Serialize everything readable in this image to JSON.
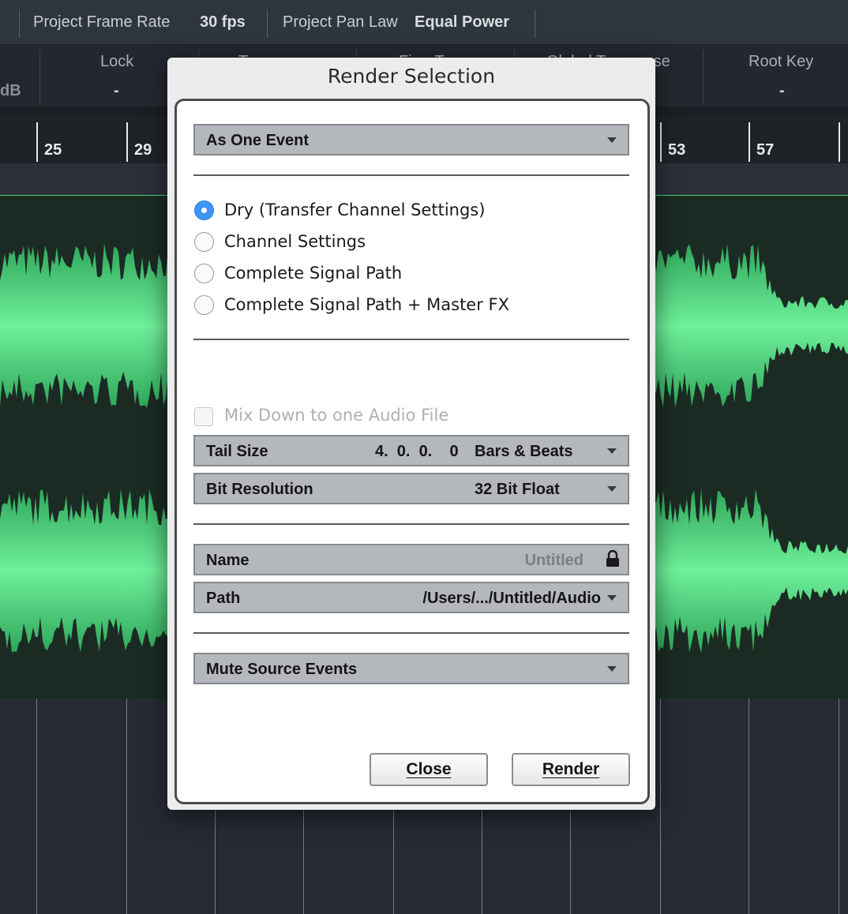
{
  "topbar": {
    "frame_rate_label": "Project Frame Rate",
    "frame_rate_value": "30 fps",
    "pan_law_label": "Project Pan Law",
    "pan_law_value": "Equal Power"
  },
  "infoline": {
    "db_value": "dB",
    "lock_label": "Lock",
    "lock_value": "-",
    "transpose_label": "Transpose",
    "fine_tune_label": "Fine-Tune",
    "global_transpose_label": "Global Transpose",
    "root_key_label": "Root Key",
    "root_key_value": "-"
  },
  "ruler": {
    "bars": [
      "25",
      "29",
      "53",
      "57"
    ]
  },
  "dialog": {
    "title": "Render Selection",
    "mode_select": "As One Event",
    "options": [
      "Dry (Transfer Channel Settings)",
      "Channel Settings",
      "Complete Signal Path",
      "Complete Signal Path + Master FX"
    ],
    "selected_option": 0,
    "mixdown_label": "Mix Down to one Audio File",
    "mixdown_checked": false,
    "tail_size_label": "Tail Size",
    "tail_size_value": "4.  0.  0.    0",
    "tail_size_unit": "Bars & Beats",
    "bit_resolution_label": "Bit Resolution",
    "bit_resolution_value": "32 Bit Float",
    "name_label": "Name",
    "name_value": "Untitled",
    "path_label": "Path",
    "path_value": "/Users/.../Untitled/Audio",
    "mute_select": "Mute Source Events",
    "close_button": "Close",
    "render_button": "Render"
  },
  "colors": {
    "accent": "#3d95f5",
    "waveform": "#4fd17a",
    "background": "#262b33"
  }
}
